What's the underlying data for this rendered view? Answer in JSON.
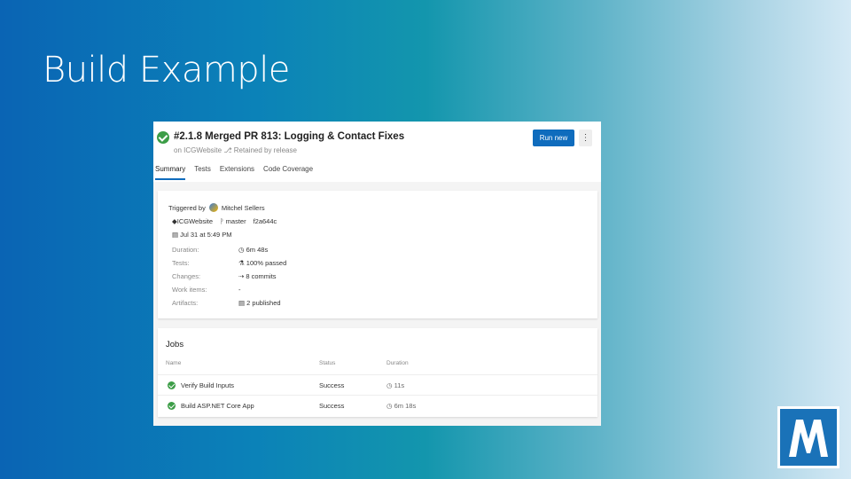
{
  "slide": {
    "title": "Build Example"
  },
  "run": {
    "title": "#2.1.8 Merged PR 813: Logging & Contact Fixes",
    "subtitle": "on ICGWebsite ⎇  Retained by release",
    "run_button": "Run new",
    "more_button": "⋮"
  },
  "tabs": [
    "Summary",
    "Tests",
    "Extensions",
    "Code Coverage"
  ],
  "summary": {
    "triggered_by_label": "Triggered by",
    "user": "Mitchel Sellers",
    "repo": "◆ICGWebsite",
    "branch": "ᚹ master",
    "commit": "f2a644c",
    "date": "▤ Jul 31 at 5:49 PM",
    "rows": [
      {
        "label": "Duration:",
        "value": "◷ 6m 48s"
      },
      {
        "label": "Tests:",
        "value": "⚗ 100% passed"
      },
      {
        "label": "Changes:",
        "value": "⇢ 8 commits"
      },
      {
        "label": "Work items:",
        "value": "-"
      },
      {
        "label": "Artifacts:",
        "value": "▤ 2 published"
      }
    ]
  },
  "jobs": {
    "title": "Jobs",
    "columns": {
      "name": "Name",
      "status": "Status",
      "duration": "Duration"
    },
    "rows": [
      {
        "name": "Verify Build Inputs",
        "status": "Success",
        "duration": "◷ 11s"
      },
      {
        "name": "Build ASP.NET Core App",
        "status": "Success",
        "duration": "◷ 6m 18s"
      }
    ]
  },
  "colors": {
    "success": "#3c9d47",
    "primary": "#0f6cbd",
    "logo": "#1a72b8"
  },
  "logo": {
    "icon": "m-logo-icon"
  }
}
